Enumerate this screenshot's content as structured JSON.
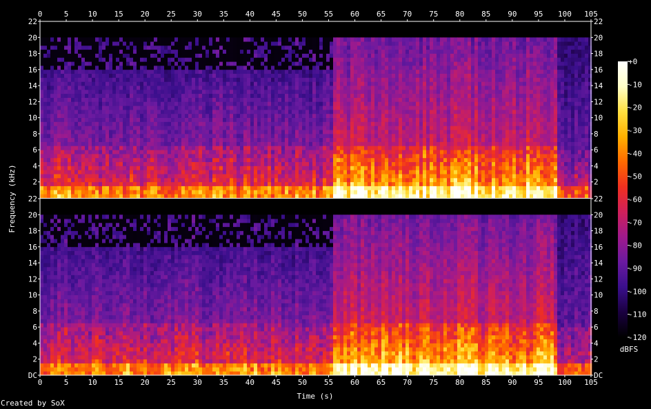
{
  "chart_data": {
    "type": "heatmap",
    "title": "",
    "xlabel": "Time (s)",
    "ylabel": "Frequency (kHz)",
    "xlim": [
      0,
      105
    ],
    "x_ticks": [
      "0",
      "5",
      "10",
      "15",
      "20",
      "25",
      "30",
      "35",
      "40",
      "45",
      "50",
      "55",
      "60",
      "65",
      "70",
      "75",
      "80",
      "85",
      "90",
      "95",
      "100",
      "105"
    ],
    "channels": [
      {
        "ylim": [
          0,
          22
        ],
        "y_ticks": [
          "22",
          "20",
          "18",
          "16",
          "14",
          "12",
          "10",
          "8",
          "6",
          "4",
          "2"
        ],
        "y_tick_values": [
          22,
          20,
          18,
          16,
          14,
          12,
          10,
          8,
          6,
          4,
          2
        ],
        "segments": [
          {
            "t": [
              0,
              55.5
            ],
            "loud_top_khz": 6.5,
            "cutoff_khz": 16,
            "sparse_to_khz": 20,
            "energy": 0.55
          },
          {
            "t": [
              55.5,
              98
            ],
            "loud_top_khz": 6.5,
            "cutoff_khz": 20,
            "sparse_to_khz": 20,
            "energy": 0.8
          },
          {
            "t": [
              98,
              105
            ],
            "loud_top_khz": 6.0,
            "cutoff_khz": 20,
            "sparse_to_khz": 20,
            "energy": 0.45
          }
        ]
      },
      {
        "ylim": [
          0,
          22
        ],
        "y_ticks": [
          "22",
          "20",
          "18",
          "16",
          "14",
          "12",
          "10",
          "8",
          "6",
          "4",
          "2",
          "DC"
        ],
        "y_tick_values": [
          22,
          20,
          18,
          16,
          14,
          12,
          10,
          8,
          6,
          4,
          2,
          0
        ],
        "segments": [
          {
            "t": [
              0,
              55.5
            ],
            "loud_top_khz": 6.5,
            "cutoff_khz": 16,
            "sparse_to_khz": 20,
            "energy": 0.55
          },
          {
            "t": [
              55.5,
              98
            ],
            "loud_top_khz": 6.5,
            "cutoff_khz": 20,
            "sparse_to_khz": 20,
            "energy": 0.8
          },
          {
            "t": [
              98,
              105
            ],
            "loud_top_khz": 6.0,
            "cutoff_khz": 20,
            "sparse_to_khz": 20,
            "energy": 0.45
          }
        ]
      }
    ],
    "colorbar": {
      "label": "dBFS",
      "range": [
        -120,
        0
      ],
      "ticks": [
        "+0",
        "-10",
        "-20",
        "-30",
        "-40",
        "-50",
        "-60",
        "-70",
        "-80",
        "-90",
        "-100",
        "-110",
        "-120"
      ],
      "tick_values": [
        0,
        -10,
        -20,
        -30,
        -40,
        -50,
        -60,
        -70,
        -80,
        -90,
        -100,
        -110,
        -120
      ],
      "colors": [
        "#000000",
        "#1a0040",
        "#3a0f8c",
        "#6a1aa0",
        "#a01a8c",
        "#d0205a",
        "#f03020",
        "#ff6a00",
        "#ffb000",
        "#ffe040",
        "#ffffc8",
        "#ffffff"
      ]
    }
  },
  "footer": {
    "credit": "Created by SoX"
  }
}
